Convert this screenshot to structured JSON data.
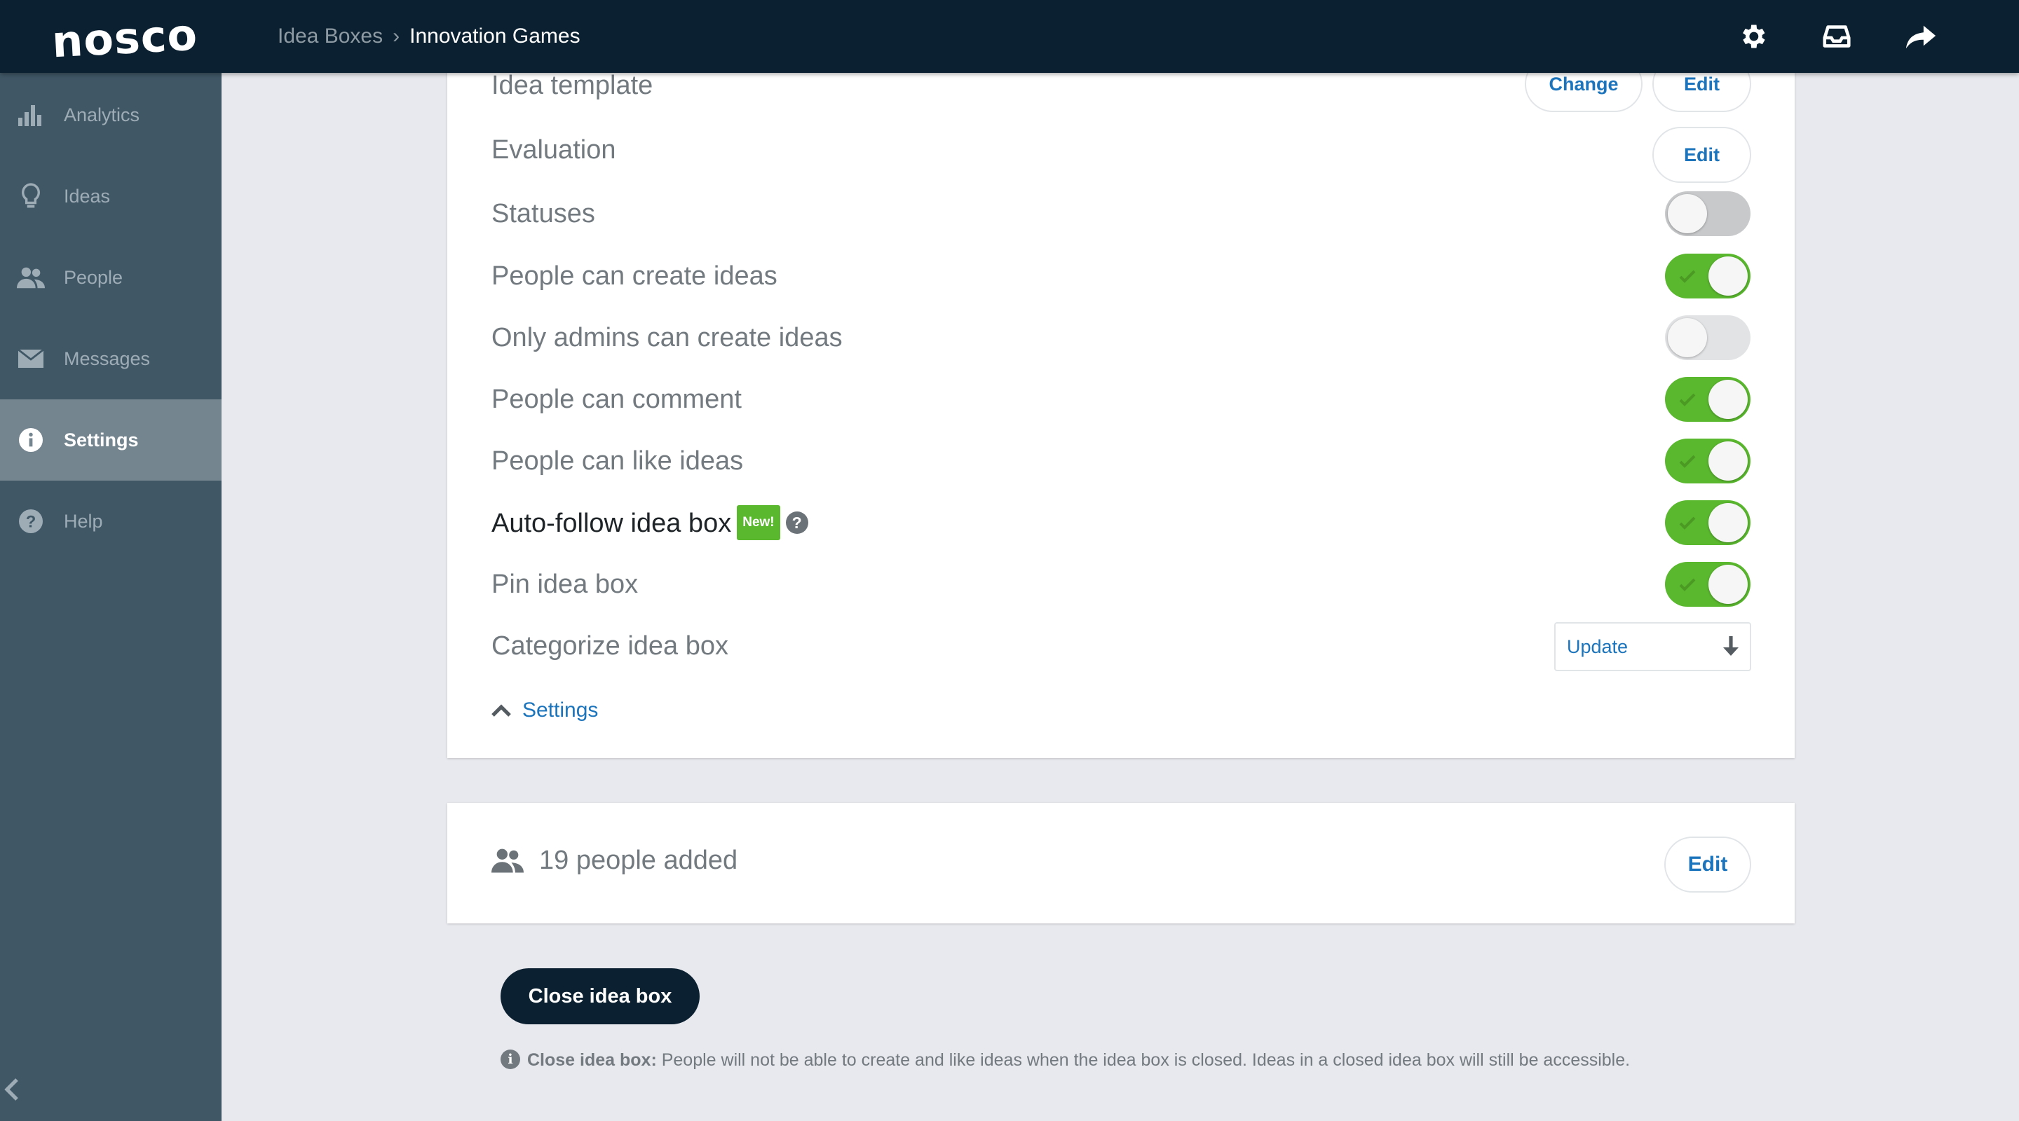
{
  "app": {
    "logo": "nosco"
  },
  "breadcrumb": {
    "parent": "Idea Boxes",
    "separator": "›",
    "current": "Innovation Games"
  },
  "topbar": {
    "icons": [
      "gear-icon",
      "inbox-icon",
      "share-arrow-icon"
    ]
  },
  "sidebar": {
    "items": [
      {
        "label": "Analytics",
        "icon": "bar-chart-icon",
        "active": false
      },
      {
        "label": "Ideas",
        "icon": "lightbulb-icon",
        "active": false
      },
      {
        "label": "People",
        "icon": "people-icon",
        "active": false
      },
      {
        "label": "Messages",
        "icon": "envelope-icon",
        "active": false
      },
      {
        "label": "Settings",
        "icon": "info-icon",
        "active": true
      },
      {
        "label": "Help",
        "icon": "question-icon",
        "active": false
      }
    ],
    "collapse_icon": "chevron-left-icon"
  },
  "settings": {
    "idea_template": {
      "label": "Idea template",
      "change_label": "Change",
      "edit_label": "Edit"
    },
    "evaluation": {
      "label": "Evaluation",
      "edit_label": "Edit"
    },
    "toggles": [
      {
        "label": "Statuses",
        "on": false
      },
      {
        "label": "People can create ideas",
        "on": true
      },
      {
        "label": "Only admins can create ideas",
        "on": false
      },
      {
        "label": "People can comment",
        "on": true
      },
      {
        "label": "People can like ideas",
        "on": true
      },
      {
        "label": "Auto-follow idea box",
        "on": true,
        "badge": "New!",
        "help": "?"
      },
      {
        "label": "Pin idea box",
        "on": true
      }
    ],
    "categorize": {
      "label": "Categorize idea box",
      "select_value": "Update"
    },
    "collapse_link": "Settings"
  },
  "people": {
    "text": "19 people added",
    "edit_label": "Edit"
  },
  "close_box": {
    "button_label": "Close idea box",
    "note_title": "Close idea box:",
    "note_text": "People will not be able to create and like ideas when the idea box is closed. Ideas in a closed idea box will still be accessible."
  },
  "colors": {
    "topbar": "#0b2030",
    "sidebar": "#405766",
    "sidebar_active": "#75858f",
    "toggle_on": "#5ab82e",
    "link": "#1c75bc"
  }
}
